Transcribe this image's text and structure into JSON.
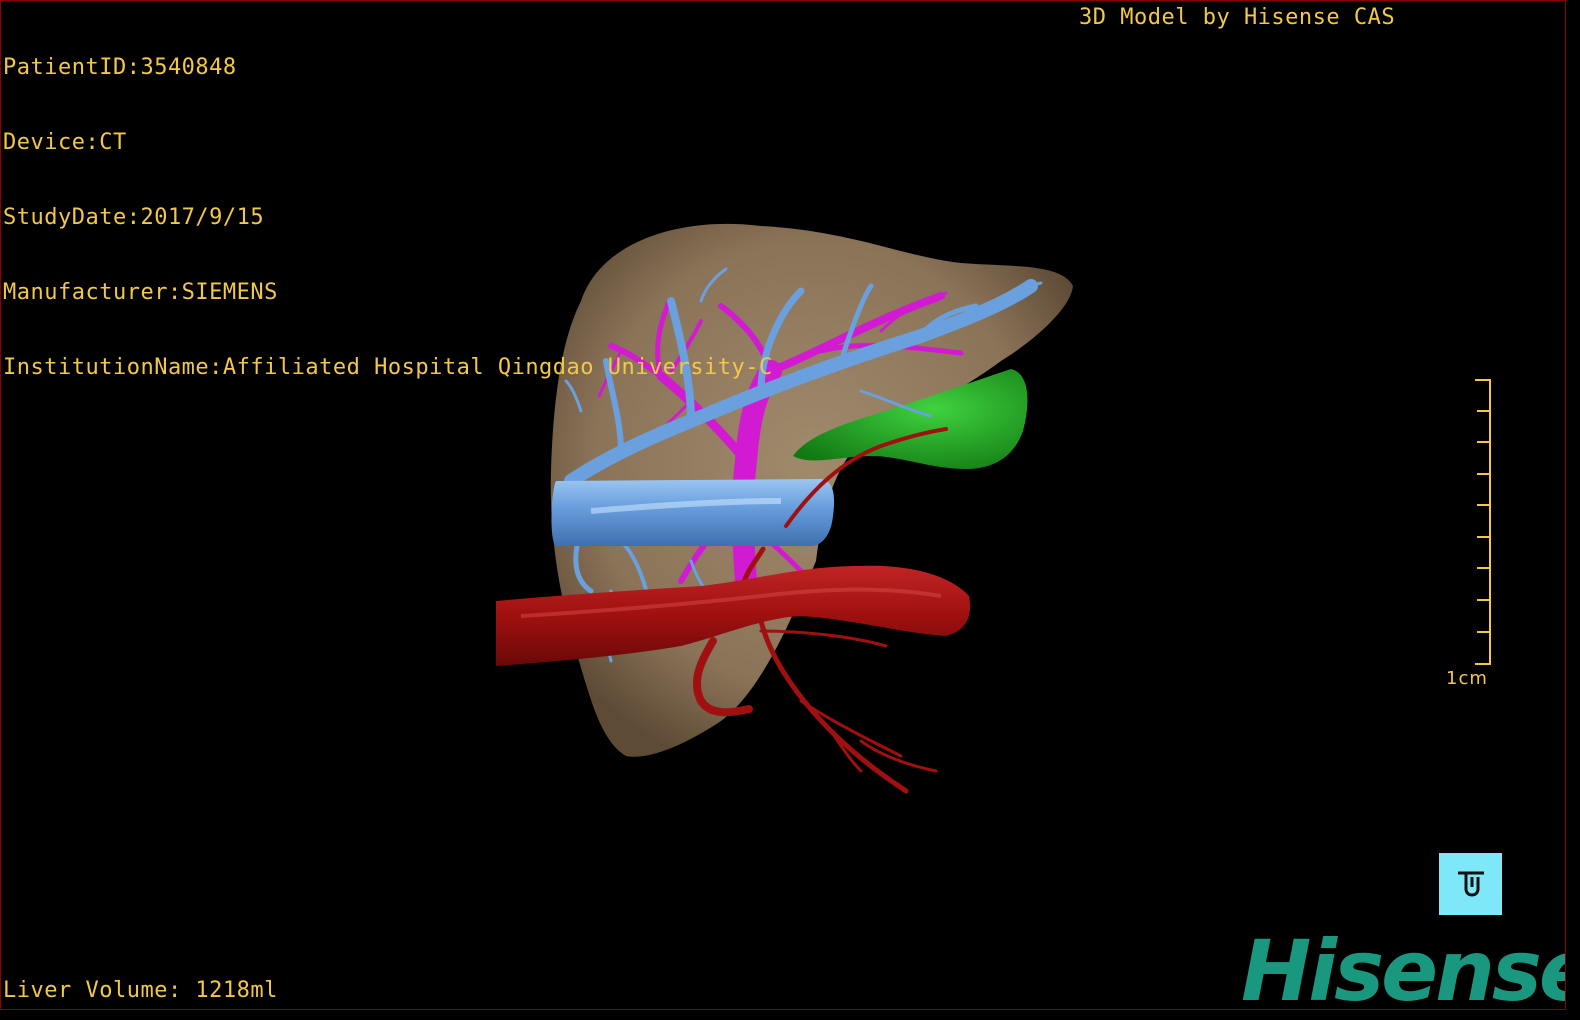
{
  "patient_info": {
    "patient_id": "PatientID:3540848",
    "device": "Device:CT",
    "study_date": "StudyDate:2017/9/15",
    "manufacturer": "Manufacturer:SIEMENS",
    "institution": "InstitutionName:Affiliated Hospital Qingdao University-C"
  },
  "credit": "3D Model by Hisense CAS",
  "liver_volume": "Liver Volume: 1218ml",
  "scale": {
    "label": "1cm"
  },
  "logo": "Hisense",
  "colors": {
    "overlay_text": "#f2c84b",
    "liver": "#8b7358",
    "hepatic_vein": "#6aa0de",
    "portal_vein": "#d21ad2",
    "artery": "#a01010",
    "gallbladder": "#1fa11f",
    "logo": "#19987f",
    "orientation_button": "#7ee8f8"
  },
  "icons": {
    "orientation": "orientation-cube-icon"
  }
}
